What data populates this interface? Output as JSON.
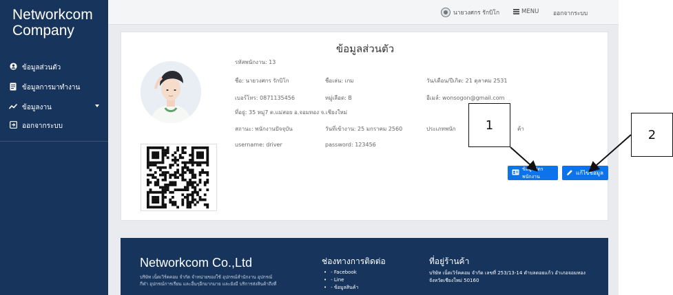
{
  "sidebar": {
    "brand": "Networkcom Company",
    "items": [
      {
        "label": "ข้อมูลส่วนตัว",
        "icon": "user-circle-icon"
      },
      {
        "label": "ข้อมูลการมาทำงาน",
        "icon": "id-card-icon"
      },
      {
        "label": "ข้อมูลงาน",
        "icon": "chart-line-icon"
      },
      {
        "label": "ออกจากระบบ",
        "icon": "logout-icon"
      }
    ]
  },
  "topbar": {
    "user_name": "นายวงศกร รักบิโก",
    "menu_label": "MENU",
    "logout_label": "ออกจากระบบ"
  },
  "profile": {
    "title": "ข้อมูลส่วนตัว",
    "employee_id": "รหัสพนักงาน: 13",
    "name": "ชื่อ: นายวงศกร รักบิโก",
    "nickname": "ชื่อเล่น: เกม",
    "birthdate": "วัน/เดือน/ปีเกิด: 21 ตุลาคม 2531",
    "phone": "เบอร์โทร: 0871135456",
    "blood": "หมู่เลือด: B",
    "email": "อีเมล์: wonsogon@gmail.com",
    "address": "ที่อยู่: 35 หมู่7 ต.แม่สอย อ.จอมทอง จ.เชียงใหม่",
    "status": "สถานะ: พนักงานปัจจุบัน",
    "start_date": "วันที่เข้างาน: 25 มกราคม 2560",
    "type": "ประเภทพนัก",
    "type_tail": "ค้า",
    "username": "username: driver",
    "password": "password: 123456",
    "btn_card_label": "ข้อมูลบัตรพนักงาน",
    "btn_edit_label": "แก้ไขข้อมูล"
  },
  "footer": {
    "brand": "Networkcom Co.,Ltd",
    "desc": "บริษัท เน็ตเวิร์คคอม จำกัด จำหน่ายของใช้ อุปกรณ์สำนักงาน อุปกรณ์กีฬา อุปกรณ์การเรียน และอื่นๆอีกมากมาย และยังมี บริการส่งสินค้าถึงที่",
    "contact_title": "ช่องทางการติดต่อ",
    "contact_items": [
      "- Facebook",
      "- Line",
      "- ข้อมูลสินค้า"
    ],
    "address_title": "ที่อยู่ร้านค้า",
    "address": "บริษัท เน็ตเวิร์คคอม จำกัด เลขที่ 253/13-14 ตำบลดอยแก้ว อำเภอจอมทอง จังหวัดเชียงใหม่ 50160"
  },
  "annotations": [
    "1",
    "2"
  ],
  "colors": {
    "sidebar": "#17355c",
    "accent": "#0d73ea",
    "content_bg": "#e9ebef"
  }
}
